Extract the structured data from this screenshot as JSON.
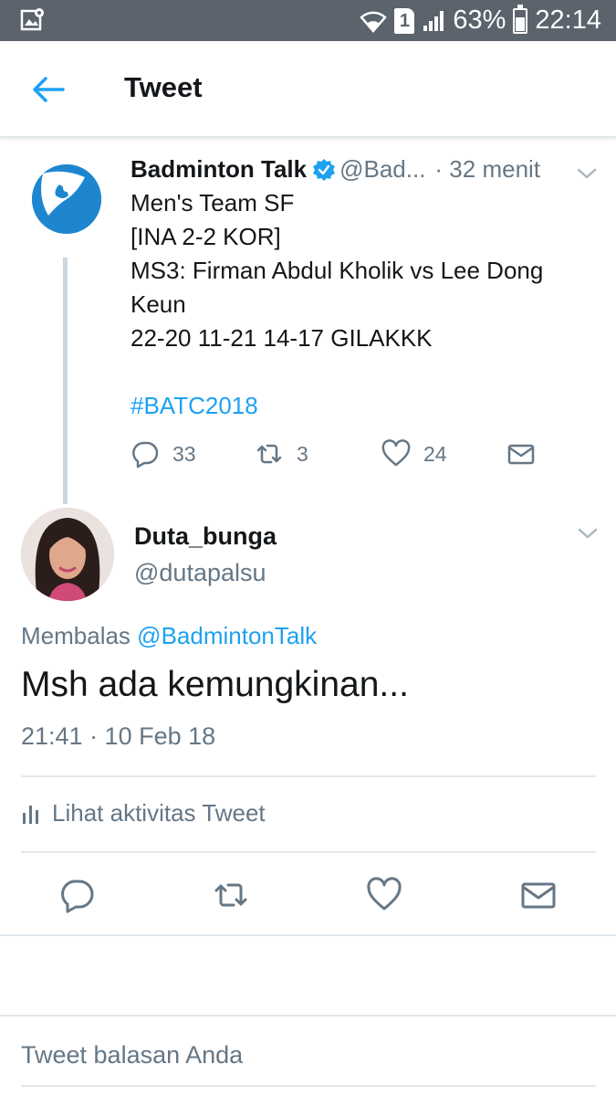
{
  "status_bar": {
    "battery": "63%",
    "time": "22:14",
    "sim_label": "1",
    "icons": [
      "gallery-notification-icon",
      "wifi-icon",
      "sim-icon",
      "signal-icon",
      "battery-icon"
    ]
  },
  "header": {
    "title": "Tweet",
    "back_icon": "back-arrow-icon"
  },
  "parent_tweet": {
    "name": "Badminton Talk",
    "handle": "@Bad...",
    "time": "· 32 menit",
    "lines": [
      "Men's Team SF",
      "[INA 2-2 KOR]",
      "MS3: Firman Abdul Kholik vs Lee Dong",
      "Keun",
      "22-20 11-21 14-17 GILAKKK",
      "",
      "#BATC2018"
    ],
    "reply_count": "33",
    "retweet_count": "3",
    "like_count": "24"
  },
  "main_tweet": {
    "name": "Duta_bunga",
    "handle": "@dutapalsu",
    "reply_prefix": "Membalas",
    "reply_mention": "@BadmintonTalk",
    "text": "Msh ada kemungkinan...",
    "timestamp": "21:41 · 10 Feb 18",
    "activity_label": "Lihat aktivitas Tweet"
  },
  "composer": {
    "placeholder": "Tweet balasan Anda"
  },
  "colors": {
    "accent": "#1da1f2",
    "muted": "#657786",
    "divider": "#e1e8ed",
    "status_bar": "#5b636d"
  }
}
